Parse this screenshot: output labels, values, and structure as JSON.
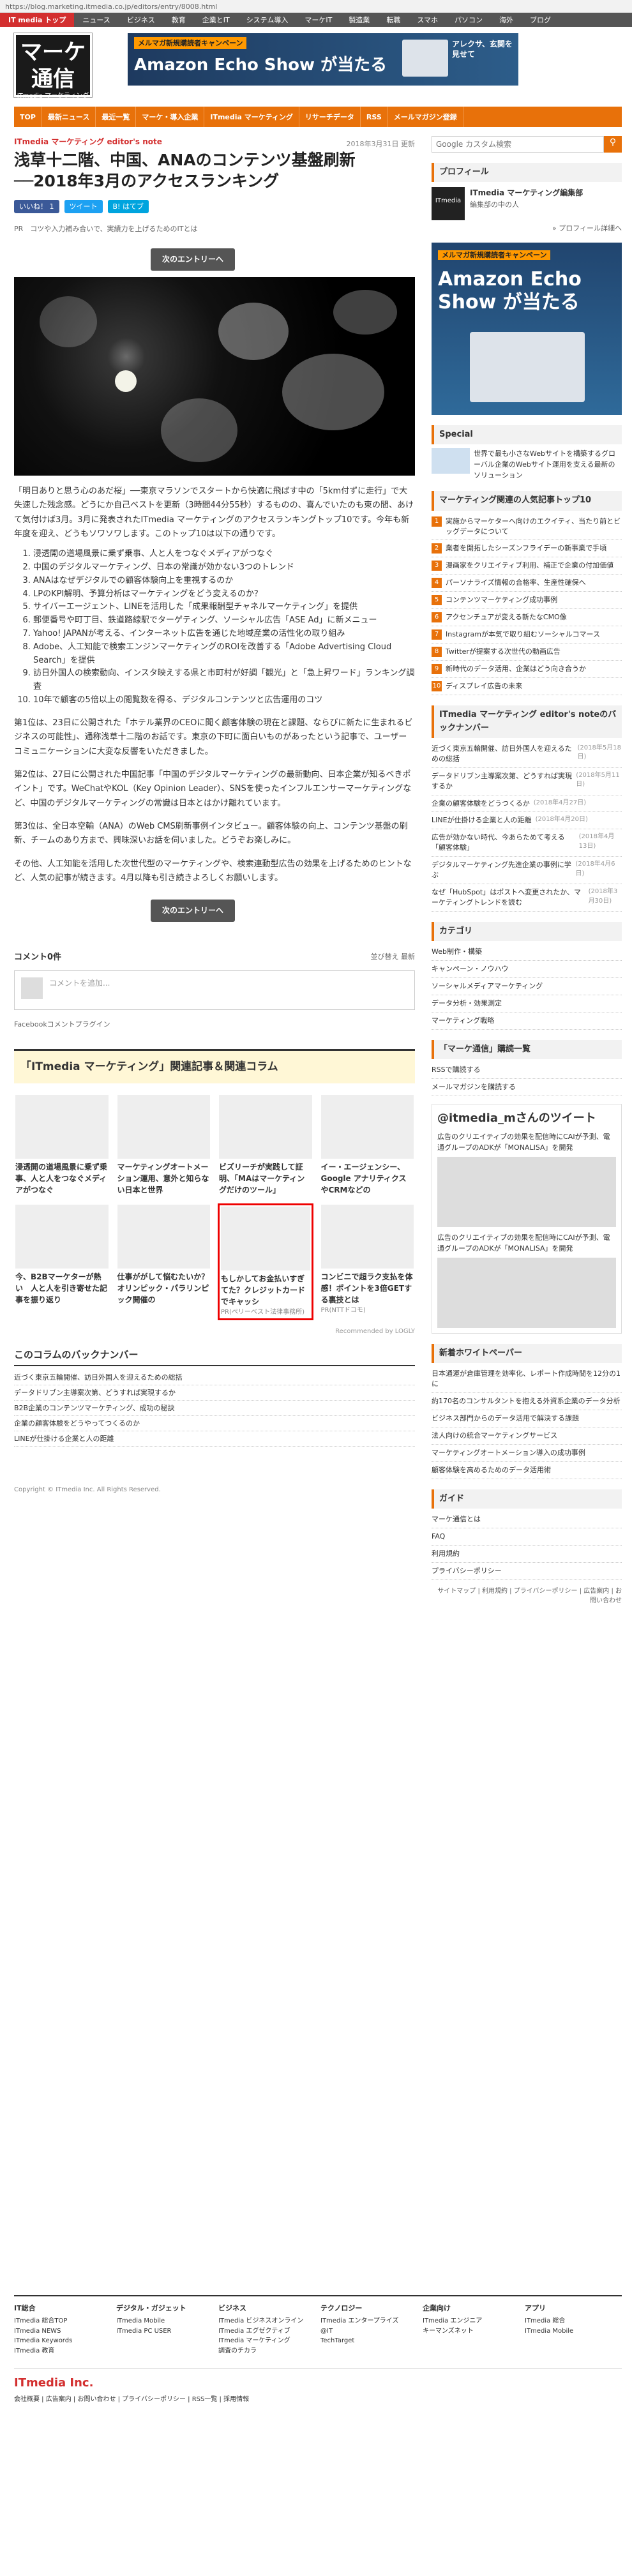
{
  "url": "https://blog.marketing.itmedia.co.jp/editors/entry/8008.html",
  "top_nav": [
    "IT media トップ",
    "ニュース",
    "ビジネス",
    "教育",
    "企業とIT",
    "システム導入",
    "マーケIT",
    "製造業",
    "転職",
    "スマホ",
    "パソコン",
    "海外",
    "ブログ"
  ],
  "logo": {
    "line1": "マーケ",
    "line2": "通信",
    "sub": "ITmedia マーケティング"
  },
  "header_ad": {
    "caption": "メルマガ新規購読者キャンペーン",
    "big": "Amazon Echo Show が当たる",
    "side": "アレクサ、玄関を見せて"
  },
  "global_nav": [
    "TOP",
    "最新ニュース",
    "最近一覧",
    "マーケ・導入企業",
    "ITmedia マーケティング",
    "リサーチデータ",
    "RSS",
    "メールマガジン登録"
  ],
  "article": {
    "kicker": "ITmedia マーケティング editor's note",
    "title": "浅草十二階、中国、ANAのコンテンツ基盤刷新──2018年3月のアクセスランキング",
    "date": "2018年3月31日 更新",
    "shares": [
      {
        "label": "いいね！ 1",
        "color": "#3b5998"
      },
      {
        "label": "ツイート",
        "color": "#1da1f2"
      },
      {
        "label": "B! はてブ",
        "color": "#00a4de"
      }
    ],
    "pr": "PR　コツや入力補み合いで、実績力を上げるためのITとは",
    "next": "次のエントリーへ",
    "p1": "「明日ありと思う心のあだ桜」──東京マラソンでスタートから快適に飛ばす中の「5km付ずに走行」で大失速した残念感。どうにか自己ベストを更新（3時間44分55秒）するものの、喜んでいたのも束の間、あけて気付けば3月。3月に発表されたITmedia マーケティングのアクセスランキングトップ10です。今年も新年度を迎え、どうもソワソワします。このトップ10は以下の通りです。",
    "list": [
      "浸透開の道場風景に乗ず乗事、人と人をつなぐメディアがつなぐ",
      "中国のデジタルマーケティング、日本の常識が効かない3つのトレンド",
      "ANAはなぜデジタルでの顧客体験向上を重視するのか",
      "LPのKPI解明、予算分析はマーケティングをどう変えるのか？",
      "サイバーエージェント、LINEを活用した「成果報酬型チャネルマーケティング」を提供",
      "郵便番号や町丁目、鉄道路線駅でターゲティング、ソーシャル広告「ASE Ad」に新メニュー",
      "Yahoo! JAPANが考える、インターネット広告を通じた地域産業の活性化の取り組み",
      "Adobe、人工知能で検索エンジンマーケティングのROIを改善する「Adobe Advertising Cloud Search」を提供",
      "訪日外国人の検索動向、インスタ映えする県と市町村が好調「観光」と「急上昇ワード」ランキング調査",
      "10年で顧客の5倍以上の閲覧数を得る、デジタルコンテンツと広告運用のコツ"
    ],
    "p2": "第1位は、23日に公開された「ホテル業界のCEOに聞く顧客体験の現在と課題、ならびに新たに生まれるビジネスの可能性」、通称浅草十二階のお話です。東京の下町に面白いものがあったという記事で、ユーザーコミュニケーションに大変な反響をいただきました。",
    "p3": "第2位は、27日に公開された中国記事「中国のデジタルマーケティングの最新動向、日本企業が知るべきポイント」です。WeChatやKOL（Key Opinion Leader）、SNSを使ったインフルエンサーマーケティングなど、中国のデジタルマーケティングの常識は日本とはかけ離れています。",
    "p4": "第3位は、全日本空輸（ANA）のWeb CMS刷新事例インタビュー。顧客体験の向上、コンテンツ基盤の刷新、チームのあり方まで、興味深いお話を伺いました。どうぞお楽しみに。",
    "p5": "その他、人工知能を活用した次世代型のマーケティングや、検索連動型広告の効果を上げるためのヒントなど、人気の記事が続きます。4月以降も引き続きよろしくお願いします。"
  },
  "comments": {
    "heading": "コメント0件",
    "sort": "並び替え 最新",
    "placeholder": "コメントを追加...",
    "plugin": "Facebookコメントプラグイン"
  },
  "related": {
    "heading": "「ITmedia マーケティング」関連記事＆関連コラム",
    "cards": [
      {
        "title": "浸透開の道場風景に乗ず乗事、人と人をつなぐメディアがつなぐ"
      },
      {
        "title": "マーケティングオートメーション運用、意外と知らない日本と世界"
      },
      {
        "title": "ビズリーチが実践して証明、「MAはマーケティングだけのツール」"
      },
      {
        "title": "イー・エージェンシー、Google アナリティクスやCRMなどの"
      },
      {
        "title": "今、B2Bマーケターが熱い　人と人を引き寄せた記事を振り返り"
      },
      {
        "title": "仕事ががして悩むたいか？ オリンピック・パラリンピック開催の"
      },
      {
        "title": "もしかしてお金払いすぎてた？クレジットカードでキャッシ",
        "pr": "PR(ペリーベスト法律事務所)",
        "hl": true
      },
      {
        "title": "コンビニで超ラク支払を体感！ポイントを3倍GETする裏技とは",
        "pr": "PR(NTTドコモ)"
      }
    ],
    "recommended": "Recommended by LOGLY"
  },
  "backnumber": {
    "heading": "このコラムのバックナンバー",
    "items": [
      "近づく東京五輪開催、訪日外国人を迎えるための総括",
      "データドリブン主導案次第、どうすれば実現するか",
      "B2B企業のコンテンツマーケティング、成功の秘訣",
      "企業の顧客体験をどうやってつくるのか",
      "LINEが仕掛ける企業と人の距離"
    ]
  },
  "copyright": "Copyright © ITmedia Inc. All Rights Reserved.",
  "sidebar": {
    "search_placeholder": "Google カスタム検索",
    "profile_heading": "プロフィール",
    "profile_name": "ITmedia マーケティング編集部",
    "profile_desc": "編集部の中の人",
    "profile_more": "» プロフィール詳細へ",
    "ad_caption": "メルマガ新規購読者キャンペーン",
    "ad_big": "Amazon Echo Show が当たる",
    "special_heading": "Special",
    "special_text": "世界で最も小さなWebサイトを構築するグローバル企業のWebサイト運用を支える最新のソリューション",
    "ranking_heading": "マーケティング関連の人気記事トップ10",
    "ranking": [
      "実施からマーケターへ向けのエクイティ、当たり前とビッグデータについて",
      "業者を開拓したシーズンフライデーの新事業で手頃",
      "漫画家をクリエイティブ利用、補正で企業の付加価値",
      "パーソナライズ情報の合格率、生産性確保へ",
      "コンテンツマーケティング成功事例",
      "アクセンチュアが変える新たなCMO像",
      "Instagramが本気で取り組むソーシャルコマース",
      "Twitterが提案する次世代の動画広告",
      "新時代のデータ活用、企業はどう向き合うか",
      "ディスプレイ広告の未来"
    ],
    "backnumber_heading": "ITmedia マーケティング editor's noteのバックナンバー",
    "backnumbers": [
      {
        "t": "近づく東京五輪開催、訪日外国人を迎えるための総括",
        "d": "(2018年5月18日)"
      },
      {
        "t": "データドリブン主導案次第、どうすれば実現するか",
        "d": "(2018年5月11日)"
      },
      {
        "t": "企業の顧客体験をどうつくるか",
        "d": "(2018年4月27日)"
      },
      {
        "t": "LINEが仕掛ける企業と人の距離",
        "d": "(2018年4月20日)"
      },
      {
        "t": "広告が効かない時代、今あらためて考える「顧客体験」",
        "d": "(2018年4月13日)"
      },
      {
        "t": "デジタルマーケティング先進企業の事例に学ぶ",
        "d": "(2018年4月6日)"
      },
      {
        "t": "なぜ「HubSpot」はポストへ変更されたか、マーケティングトレンドを読む",
        "d": "(2018年3月30日)"
      }
    ],
    "category_heading": "カテゴリ",
    "categories": [
      "Web制作・構築",
      "キャンペーン・ノウハウ",
      "ソーシャルメディアマーケティング",
      "データ分析・効果測定",
      "マーケティング戦略"
    ],
    "rss_heading": "「マーケ通信」購読一覧",
    "rss_items": [
      "RSSで購読する",
      "メールマガジンを購読する"
    ],
    "twitter_heading": "@itmedia_mさんのツイート",
    "twitter_text": "広告のクリエイティブの効果を配信時にCAIが予測、電通グループのADKが「MONALISA」を開発",
    "whitepaper_heading": "新着ホワイトペーパー",
    "whitepapers": [
      "日本通運が倉庫管理を効率化、レポート作成時間を12分の1に",
      "約170名のコンサルタントを抱える外資系企業のデータ分析",
      "ビジネス部門からのデータ活用で解決する課題",
      "法人向けの統合マーケティングサービス",
      "マーケティングオートメーション導入の成功事例",
      "顧客体験を高めるためのデータ活用術"
    ],
    "guide_heading": "ガイド",
    "guide": [
      "マーケ通信とは",
      "FAQ",
      "利用規約",
      "プライバシーポリシー"
    ],
    "sitemap": "サイトマップ | 利用規約 | プライバシーポリシー | 広告案内 | お問い合わせ"
  },
  "footer": {
    "cols": [
      {
        "h": "IT総合",
        "items": [
          "ITmedia 総合TOP",
          "ITmedia NEWS",
          "ITmedia Keywords",
          "ITmedia 教育"
        ]
      },
      {
        "h": "デジタル・ガジェット",
        "items": [
          "ITmedia Mobile",
          "ITmedia PC USER"
        ]
      },
      {
        "h": "ビジネス",
        "items": [
          "ITmedia ビジネスオンライン",
          "ITmedia エグゼクティブ",
          "ITmedia マーケティング",
          "調査のチカラ"
        ]
      },
      {
        "h": "テクノロジー",
        "items": [
          "ITmedia エンタープライズ",
          "@IT",
          "TechTarget"
        ]
      },
      {
        "h": "企業向け",
        "items": [
          "ITmedia エンジニア",
          "キーマンズネット"
        ]
      },
      {
        "h": "アプリ",
        "items": [
          "ITmedia 総合",
          "ITmedia Mobile"
        ]
      }
    ],
    "brand": "ITmedia Inc.",
    "links": "会社概要 | 広告案内 | お問い合わせ | プライバシーポリシー | RSS一覧 | 採用情報"
  }
}
